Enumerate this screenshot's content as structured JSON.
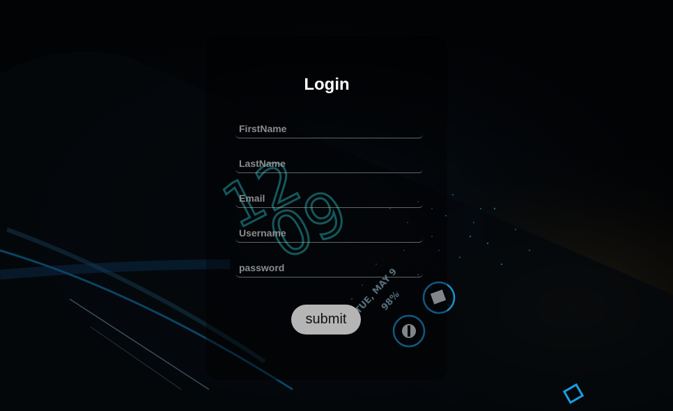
{
  "form": {
    "title": "Login",
    "fields": [
      {
        "placeholder": "FirstName",
        "type": "text"
      },
      {
        "placeholder": "LastName",
        "type": "text"
      },
      {
        "placeholder": "Email",
        "type": "email"
      },
      {
        "placeholder": "Username",
        "type": "text"
      },
      {
        "placeholder": "password",
        "type": "password"
      }
    ],
    "submit_label": "submit"
  },
  "background": {
    "phone_screen": {
      "clock_hours": "12",
      "clock_minutes": "09",
      "date": "TUE, MAY 9",
      "battery": "98%"
    },
    "colors": {
      "base": "#020305",
      "accent": "#1a8fd0",
      "clock": "#1f8f95"
    }
  }
}
